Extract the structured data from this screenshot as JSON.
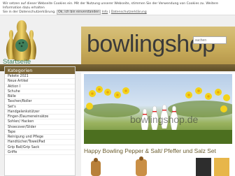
{
  "cookie": {
    "line1": "Wir setzen auf dieser Webseite Cookies ein. Mit der Nutzung unserer Webseite, stimmen Sie der Verwendung von Cookies zu. Weitere Information dazu erhalten",
    "line2_prefix": "Sie in der Datenschutzerklärung.",
    "ok": "Ok, ich bin einverstanden",
    "more_info": "Info",
    "privacy_link": "Datenschutzerklärung"
  },
  "header": {
    "logo_label": "Startseite",
    "banner_text": "bowlingshop",
    "search_placeholder": "suchen"
  },
  "sidebar": {
    "title": "Kategorien",
    "items": [
      "Pakete 2021",
      "Neue Artikel",
      "Aktion I",
      "Schuhe",
      "Bälle",
      "Taschen/Roller",
      "Set's",
      "Handgelenkstützer",
      "Finger-/Daumeneinsätze",
      "Sohlen/ Hacken",
      "Shoecover/Slider",
      "Tape",
      "Reinigung und Pflege",
      "Handtücher/Towel/Pad",
      "Grip Ball/Grip Sack",
      "Griffe"
    ]
  },
  "hero": {
    "watermark": "bowlingshop.de",
    "caption": "Happy Bowling Pepper & Salt/ Pfeffer und Salz Set"
  },
  "colors": {
    "brand_brown": "#7b6638",
    "logo_green": "#3f7f5a",
    "banner_gold": "#c9ad5c"
  }
}
